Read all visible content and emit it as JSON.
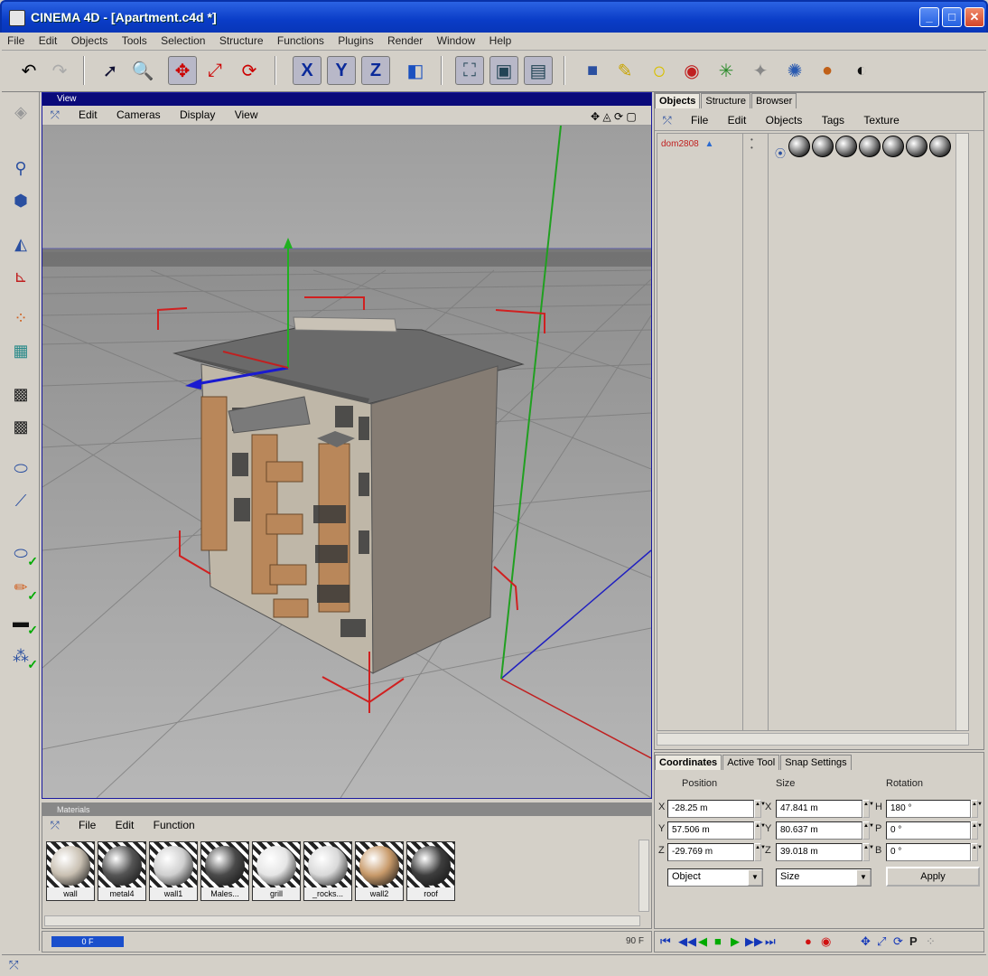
{
  "window": {
    "title": "CINEMA 4D - [Apartment.c4d *]",
    "controls": [
      "_",
      "□",
      "✕"
    ]
  },
  "menubar": [
    "File",
    "Edit",
    "Objects",
    "Tools",
    "Selection",
    "Structure",
    "Functions",
    "Plugins",
    "Render",
    "Window",
    "Help"
  ],
  "toolbar": {
    "axes": [
      "X",
      "Y",
      "Z"
    ]
  },
  "viewport": {
    "title": "View",
    "menu": [
      "Edit",
      "Cameras",
      "Display",
      "View"
    ]
  },
  "object_manager": {
    "tabs": [
      "Objects",
      "Structure",
      "Browser"
    ],
    "menu": [
      "File",
      "Edit",
      "Objects",
      "Tags",
      "Texture"
    ],
    "object_name": "dom2808"
  },
  "coordinates": {
    "tabs": [
      "Coordinates",
      "Active Tool",
      "Snap Settings"
    ],
    "headers": [
      "Position",
      "Size",
      "Rotation"
    ],
    "rows": [
      {
        "axis": "X",
        "position": "-28.25 m",
        "size_axis": "X",
        "size": "47.841 m",
        "rot_axis": "H",
        "rotation": "180 °"
      },
      {
        "axis": "Y",
        "position": "57.506 m",
        "size_axis": "Y",
        "size": "80.637 m",
        "rot_axis": "P",
        "rotation": "0 °"
      },
      {
        "axis": "Z",
        "position": "-29.769 m",
        "size_axis": "Z",
        "size": "39.018 m",
        "rot_axis": "B",
        "rotation": "0 °"
      }
    ],
    "mode_select": "Object",
    "size_select": "Size",
    "apply_label": "Apply"
  },
  "materials": {
    "title": "Materials",
    "menu": [
      "File",
      "Edit",
      "Function"
    ],
    "items": [
      {
        "name": "wall",
        "color": "#c9c0b2"
      },
      {
        "name": "metal4",
        "color": "#555555"
      },
      {
        "name": "wall1",
        "color": "#cfcfcf"
      },
      {
        "name": "Males...",
        "color": "#4a4a4a"
      },
      {
        "name": "grill",
        "color": "#e5e5e5"
      },
      {
        "name": "_rocks...",
        "color": "#d9d9d9"
      },
      {
        "name": "wall2",
        "color": "#c89a6a"
      },
      {
        "name": "roof",
        "color": "#3e3e3e"
      }
    ]
  },
  "timeline": {
    "current_frame": "0 F",
    "end_frame": "90 F"
  }
}
